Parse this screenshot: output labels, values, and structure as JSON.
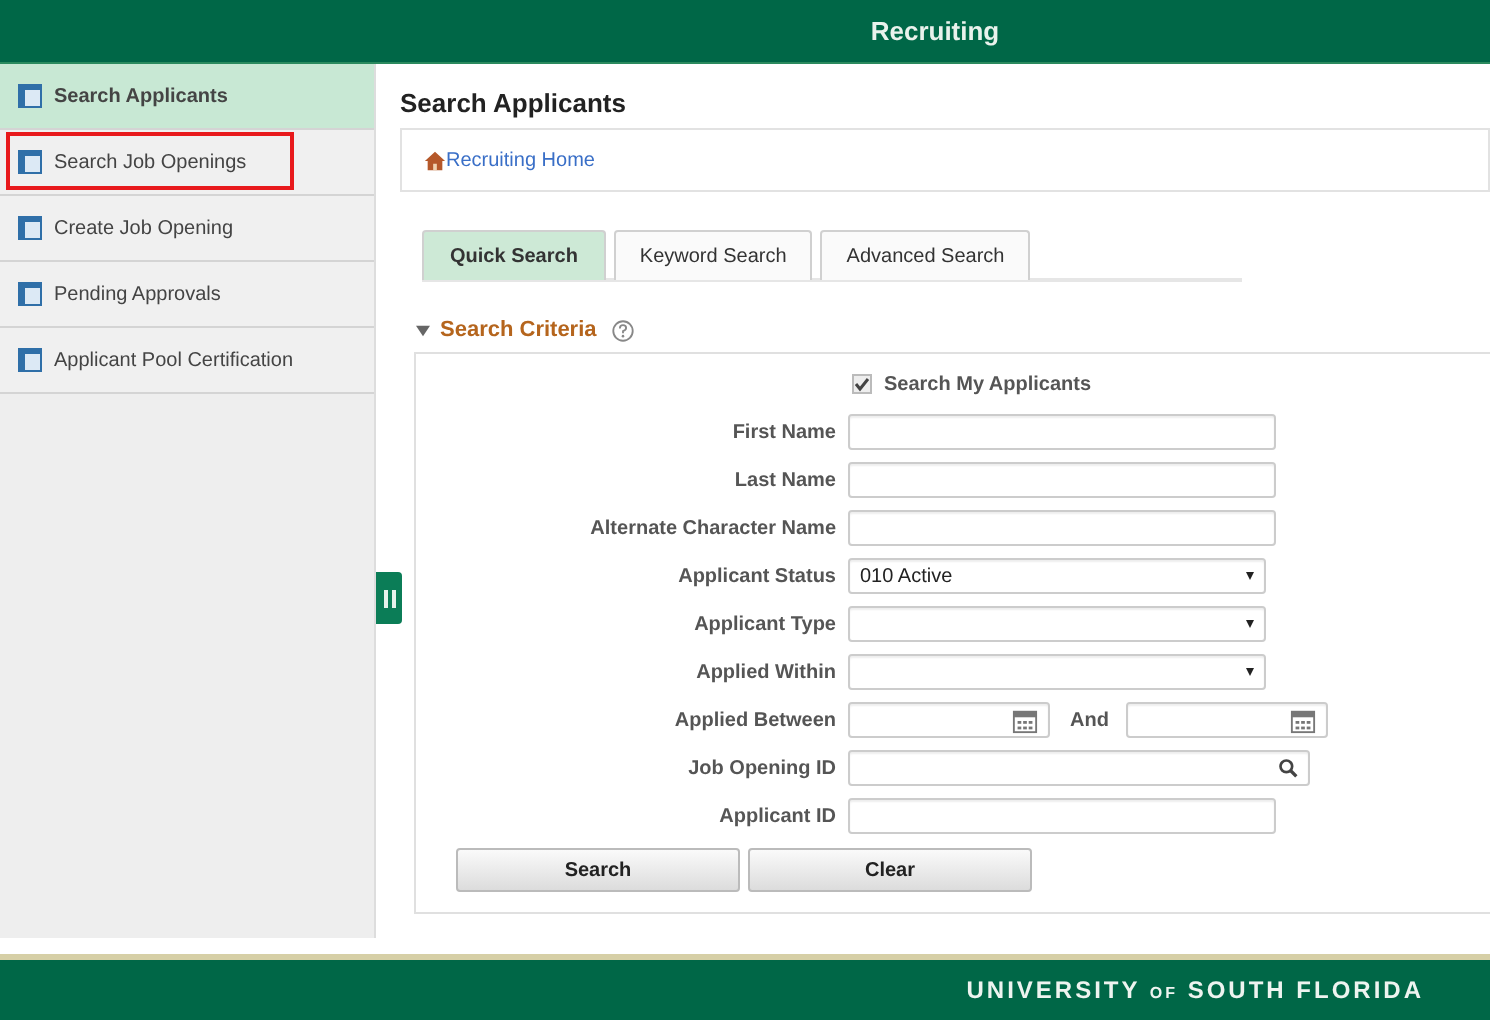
{
  "header": {
    "title": "Recruiting"
  },
  "sidebar": {
    "items": [
      {
        "label": "Search Applicants",
        "selected": true,
        "highlighted": false
      },
      {
        "label": "Search Job Openings",
        "selected": false,
        "highlighted": true
      },
      {
        "label": "Create Job Opening",
        "selected": false,
        "highlighted": false
      },
      {
        "label": "Pending Approvals",
        "selected": false,
        "highlighted": false
      },
      {
        "label": "Applicant Pool Certification",
        "selected": false,
        "highlighted": false
      }
    ]
  },
  "page": {
    "title": "Search Applicants",
    "breadcrumb": "Recruiting Home"
  },
  "tabs": [
    {
      "label": "Quick Search",
      "selected": true
    },
    {
      "label": "Keyword Search",
      "selected": false
    },
    {
      "label": "Advanced Search",
      "selected": false
    }
  ],
  "criteria": {
    "title": "Search Criteria",
    "expanded": true,
    "checkbox": {
      "label": "Search My Applicants",
      "checked": true
    },
    "fields": [
      {
        "kind": "text",
        "label": "First Name"
      },
      {
        "kind": "text",
        "label": "Last Name"
      },
      {
        "kind": "text",
        "label": "Alternate Character Name"
      },
      {
        "kind": "select",
        "label": "Applicant Status",
        "value": "010 Active"
      },
      {
        "kind": "select",
        "label": "Applicant Type"
      },
      {
        "kind": "select",
        "label": "Applied Within"
      },
      {
        "kind": "daterange",
        "label": "Applied Between",
        "joiner": "And"
      },
      {
        "kind": "lookup",
        "label": "Job Opening ID"
      },
      {
        "kind": "text",
        "label": "Applicant ID"
      }
    ],
    "buttons": [
      "Search",
      "Clear"
    ]
  },
  "footer": {
    "brand_left": "UNIVERSITY",
    "brand_mid": "OF",
    "brand_right": "SOUTH FLORIDA"
  }
}
